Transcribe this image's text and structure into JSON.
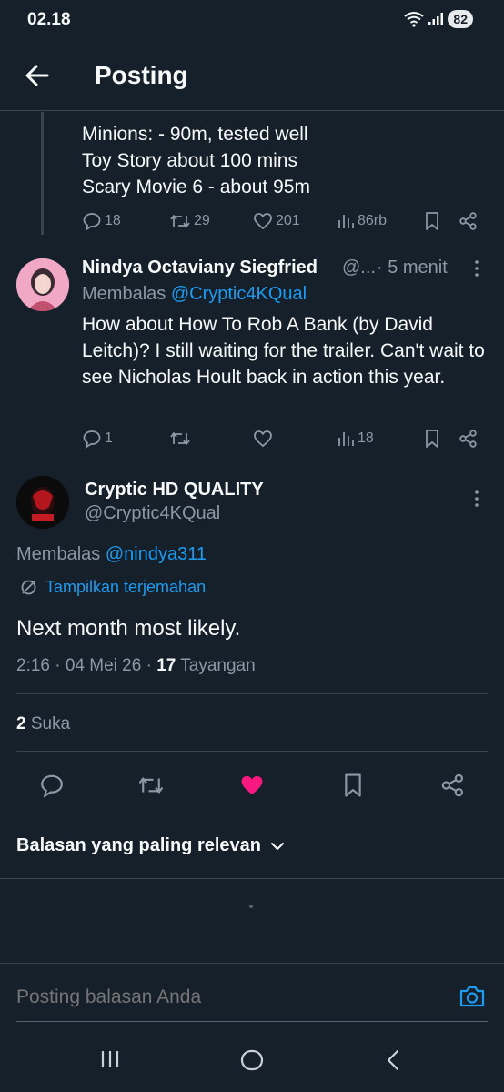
{
  "status_bar": {
    "time": "02.18",
    "battery": "82"
  },
  "header": {
    "title": "Posting"
  },
  "prev_tweet": {
    "lines": [
      "Minions: - 90m, tested well",
      "Toy Story about 100 mins",
      "Scary Movie 6 - about 95m"
    ],
    "replies": "18",
    "retweets": "29",
    "likes": "201",
    "views": "86rb"
  },
  "reply_tweet": {
    "name": "Nindya Octaviany Siegfried",
    "handle": "@...",
    "time": "· 5 menit",
    "replying_prefix": "Membalas",
    "replying_to": "@Cryptic4KQual",
    "text": "How about How To Rob A Bank (by David Leitch)? I still waiting for the trailer. Can't wait to see Nicholas Hoult back in action this year.",
    "replies": "1",
    "views": "18"
  },
  "main_tweet": {
    "name": "Cryptic HD QUALITY",
    "handle": "@Cryptic4KQual",
    "replying_prefix": "Membalas",
    "replying_to": "@nindya311",
    "translate": "Tampilkan terjemahan",
    "text": "Next month most likely.",
    "timestamp": "2:16 · 04 Mei 26 ·",
    "views_count": "17",
    "views_label": "Tayangan",
    "likes_count": "2",
    "likes_label": "Suka"
  },
  "sort": {
    "label": "Balasan yang paling relevan"
  },
  "reply_box": {
    "placeholder": "Posting balasan Anda"
  },
  "colors": {
    "background": "#15202b",
    "accent": "#1d9bf0",
    "like": "#f91880",
    "muted": "#8b98a5"
  }
}
